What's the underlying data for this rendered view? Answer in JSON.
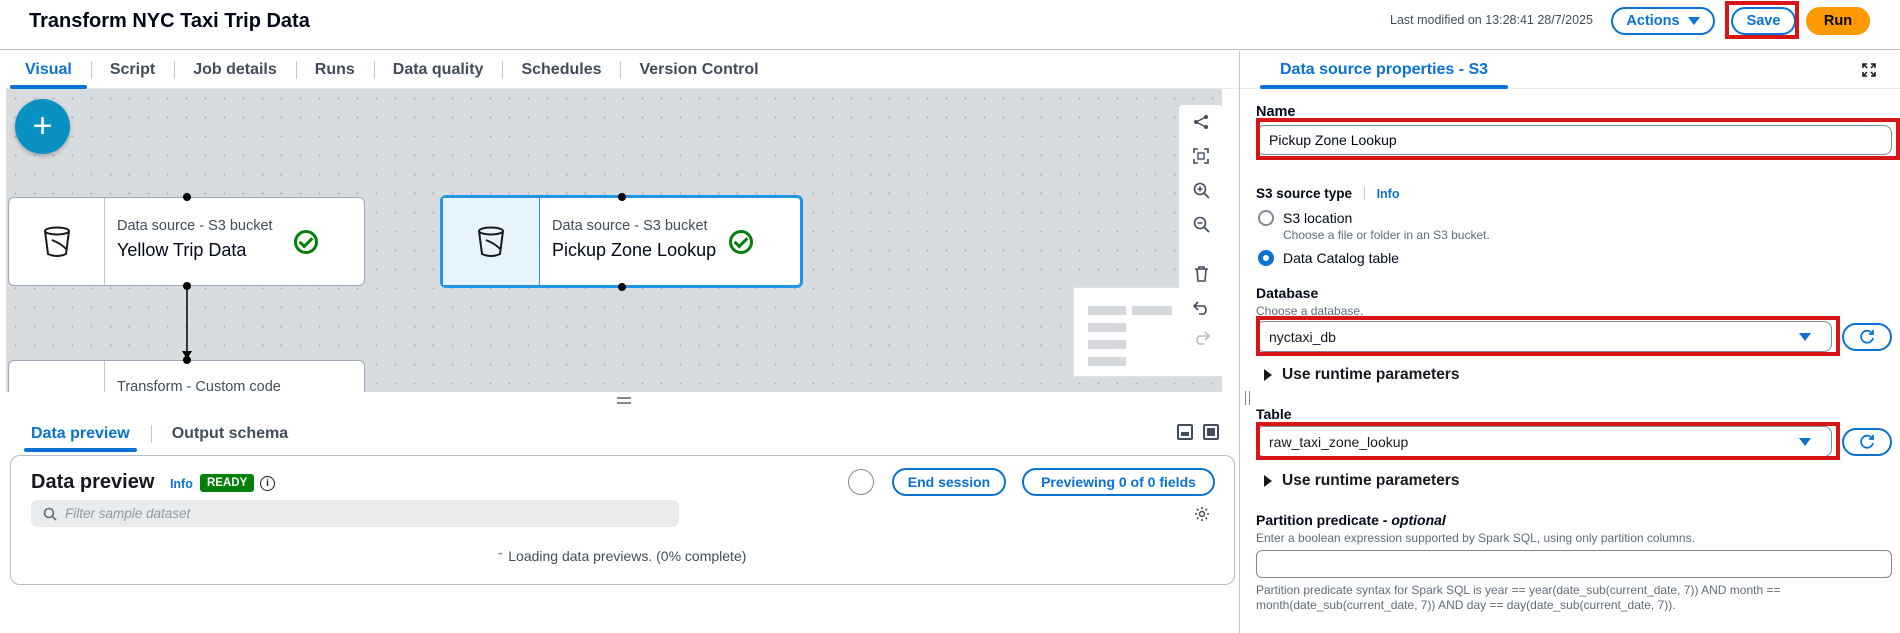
{
  "header": {
    "title": "Transform NYC Taxi Trip Data",
    "last_modified": "Last modified on 13:28:41 28/7/2025",
    "actions_label": "Actions",
    "save_label": "Save",
    "run_label": "Run"
  },
  "tabs": [
    "Visual",
    "Script",
    "Job details",
    "Runs",
    "Data quality",
    "Schedules",
    "Version Control"
  ],
  "canvas": {
    "add_icon": "plus-icon",
    "nodes": [
      {
        "type": "Data source - S3 bucket",
        "name": "Yellow Trip Data",
        "status_icon": "check-circle-icon"
      },
      {
        "type": "Data source - S3 bucket",
        "name": "Pickup Zone Lookup",
        "status_icon": "check-circle-icon"
      },
      {
        "type": "Transform - Custom code",
        "name": ""
      }
    ],
    "toolbar_icons": [
      "layout-icon",
      "fit-view-icon",
      "zoom-in-icon",
      "zoom-out-icon",
      "delete-icon",
      "undo-icon",
      "redo-icon"
    ]
  },
  "bottom": {
    "tabs": [
      "Data preview",
      "Output schema"
    ],
    "preview": {
      "title": "Data preview",
      "info": "Info",
      "status": "READY",
      "end_session": "End session",
      "previewing": "Previewing 0 of 0 fields",
      "filter_placeholder": "Filter sample dataset",
      "loading": "Loading data previews. (0% complete)"
    }
  },
  "right_panel": {
    "tab": "Data source properties - S3",
    "name_label": "Name",
    "name_value": "Pickup Zone Lookup",
    "source_type_label": "S3 source type",
    "info": "Info",
    "options": [
      {
        "label": "S3 location",
        "desc": "Choose a file or folder in an S3 bucket.",
        "selected": false
      },
      {
        "label": "Data Catalog table",
        "selected": true
      }
    ],
    "database_label": "Database",
    "database_desc": "Choose a database.",
    "database_value": "nyctaxi_db",
    "runtime_params": "Use runtime parameters",
    "table_label": "Table",
    "table_value": "raw_taxi_zone_lookup",
    "partition_label": "Partition predicate - ",
    "partition_optional": "optional",
    "partition_desc": "Enter a boolean expression supported by Spark SQL, using only partition columns.",
    "partition_value": "",
    "partition_hint": "Partition predicate syntax for Spark SQL is year == year(date_sub(current_date, 7)) AND month == month(date_sub(current_date, 7)) AND day == day(date_sub(current_date, 7))."
  },
  "colors": {
    "accent": "#0972d3",
    "run": "#ff9900",
    "ready": "#037f0c",
    "highlight": "#d91515"
  }
}
